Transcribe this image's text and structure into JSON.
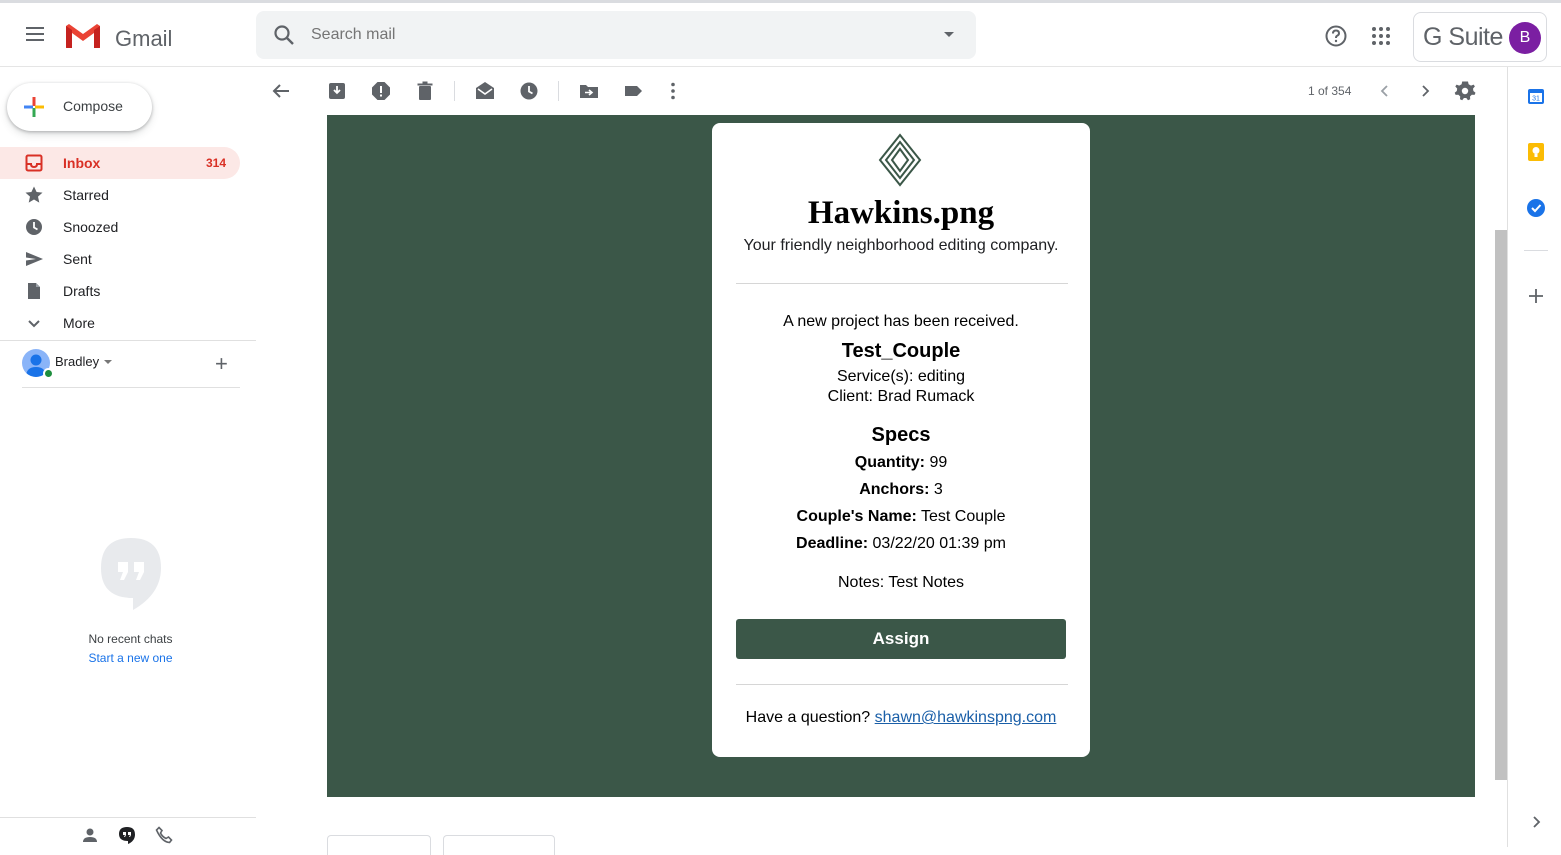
{
  "header": {
    "app_name": "Gmail",
    "search_placeholder": "Search mail",
    "gsuite_label": "G Suite",
    "avatar_letter": "B"
  },
  "sidebar": {
    "compose_label": "Compose",
    "items": [
      {
        "label": "Inbox",
        "count": "314",
        "icon": "inbox-icon"
      },
      {
        "label": "Starred",
        "count": "",
        "icon": "star-icon"
      },
      {
        "label": "Snoozed",
        "count": "",
        "icon": "clock-icon"
      },
      {
        "label": "Sent",
        "count": "",
        "icon": "send-icon"
      },
      {
        "label": "Drafts",
        "count": "",
        "icon": "draft-icon"
      },
      {
        "label": "More",
        "count": "",
        "icon": "chevron-down-icon"
      }
    ],
    "user_name": "Bradley",
    "no_chats_text": "No recent chats",
    "start_new_text": "Start a new one"
  },
  "toolbar": {
    "pager_text": "1 of 354"
  },
  "email": {
    "brand": "Hawkins.png",
    "tagline": "Your friendly neighborhood editing company.",
    "notice": "A new project has been received.",
    "project_name": "Test_Couple",
    "services": "Service(s): editing",
    "client": "Client: Brad Rumack",
    "specs_heading": "Specs",
    "specs": [
      {
        "label": "Quantity:",
        "value": "99"
      },
      {
        "label": "Anchors:",
        "value": "3"
      },
      {
        "label": "Couple's Name:",
        "value": "Test Couple"
      },
      {
        "label": "Deadline:",
        "value": "03/22/20 01:39 pm"
      }
    ],
    "notes": "Notes: Test Notes",
    "assign_label": "Assign",
    "question_text": "Have a question?",
    "contact_email": "shawn@hawkinspng.com"
  },
  "colors": {
    "email_bg": "#3b5748",
    "accent_red": "#d93025",
    "link_blue": "#1a5fa8"
  }
}
